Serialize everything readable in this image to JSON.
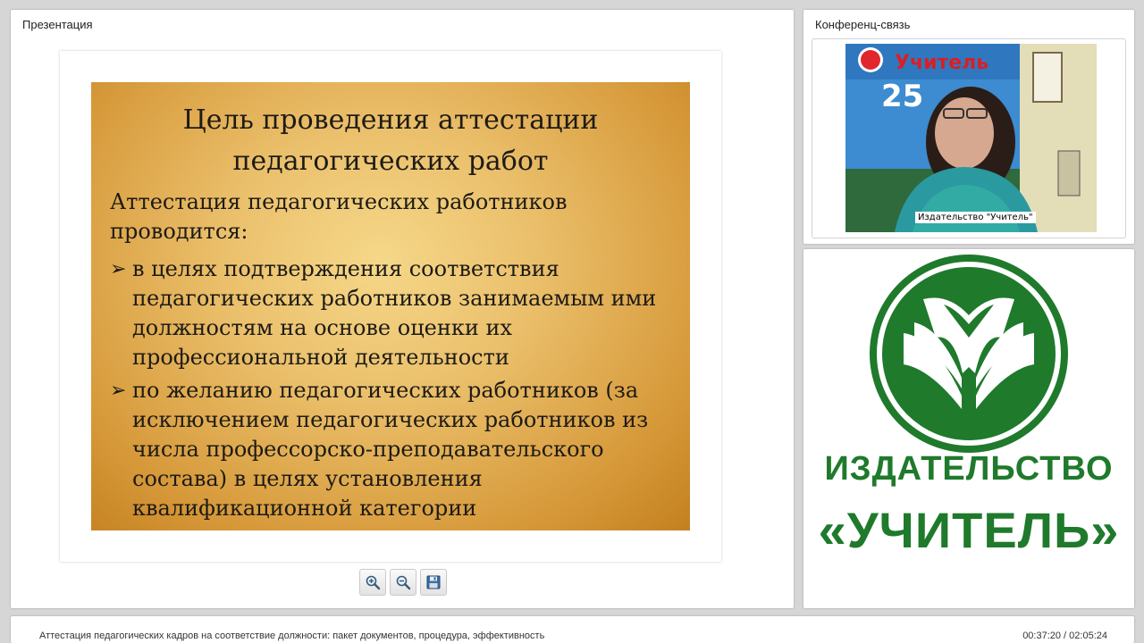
{
  "presentation": {
    "title": "Презентация",
    "slide": {
      "title_line1": "Цель проведения аттестации",
      "title_line2": "педагогических работ",
      "intro": "Аттестация педагогических работников проводится:",
      "bullet_mark": "➢",
      "bullets": [
        "в целях подтверждения соответствия педагогических работников занимаемым ими должностям на основе оценки их профессиональной деятельности",
        "по желанию педагогических работников (за исключением педагогических работников из числа профессорско-преподавательского состава) в целях установления квалификационной категории"
      ]
    },
    "controls": {
      "zoom_in": "zoom-in-icon",
      "zoom_out": "zoom-out-icon",
      "save": "save-icon"
    }
  },
  "conference": {
    "title": "Конференц-связь",
    "caption": "Издательство \"Учитель\"",
    "banner_text": "Учитель",
    "banner_number": "25"
  },
  "publisher": {
    "line1": "ИЗДАТЕЛЬСТВО",
    "line2": "«УЧИТЕЛЬ»",
    "brand_color": "#1f7a2c"
  },
  "footer": {
    "title": "Аттестация педагогических кадров на соответствие должности: пакет документов, процедура, эффективность",
    "time": "00:37:20 / 02:05:24"
  }
}
